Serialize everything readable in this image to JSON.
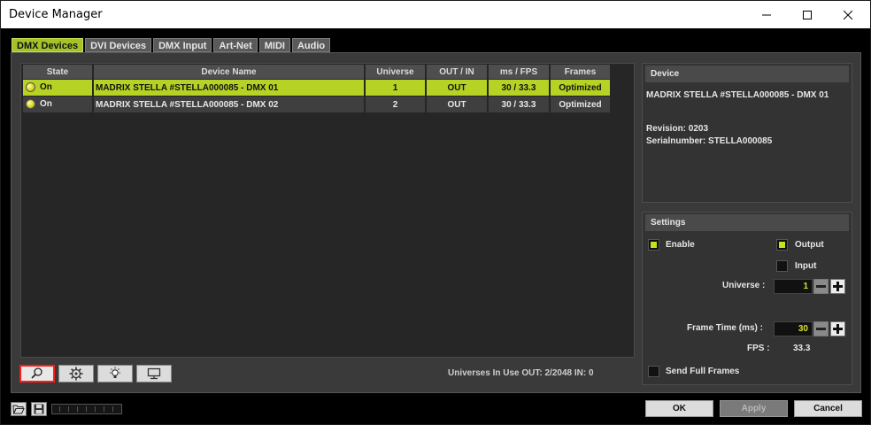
{
  "window": {
    "title": "Device Manager"
  },
  "tabs": [
    {
      "label": "DMX Devices",
      "active": true
    },
    {
      "label": "DVI Devices",
      "active": false
    },
    {
      "label": "DMX Input",
      "active": false
    },
    {
      "label": "Art-Net",
      "active": false
    },
    {
      "label": "MIDI",
      "active": false
    },
    {
      "label": "Audio",
      "active": false
    }
  ],
  "table": {
    "headers": [
      "State",
      "Device Name",
      "Universe",
      "OUT / IN",
      "ms / FPS",
      "Frames"
    ],
    "rows": [
      {
        "state": "On",
        "name": "MADRIX STELLA #STELLA000085 - DMX 01",
        "universe": "1",
        "direction": "OUT",
        "ms_fps": "30 / 33.3",
        "frames": "Optimized",
        "selected": true
      },
      {
        "state": "On",
        "name": "MADRIX STELLA #STELLA000085 - DMX 02",
        "universe": "2",
        "direction": "OUT",
        "ms_fps": "30 / 33.3",
        "frames": "Optimized",
        "selected": false
      }
    ]
  },
  "toolbar": {
    "icons": [
      "search-icon",
      "gear-icon",
      "bulb-icon",
      "monitor-icon"
    ]
  },
  "status": {
    "universes_in_use": "Universes In Use OUT: 2/2048  IN: 0"
  },
  "device": {
    "header": "Device",
    "name": "MADRIX STELLA #STELLA000085 - DMX 01",
    "revision": "Revision: 0203",
    "serial": "Serialnumber: STELLA000085"
  },
  "settings": {
    "header": "Settings",
    "enable_label": "Enable",
    "enable_checked": true,
    "output_label": "Output",
    "output_checked": true,
    "input_label": "Input",
    "input_checked": false,
    "universe_label": "Universe :",
    "universe_value": "1",
    "frame_time_label": "Frame Time (ms) :",
    "frame_time_value": "30",
    "fps_label": "FPS :",
    "fps_value": "33.3",
    "send_full_frames_label": "Send Full Frames",
    "send_full_frames_checked": false
  },
  "buttons": {
    "ok": "OK",
    "apply": "Apply",
    "cancel": "Cancel"
  },
  "colors": {
    "accent": "#b6d325",
    "background": "#000000",
    "panel": "#333333"
  }
}
